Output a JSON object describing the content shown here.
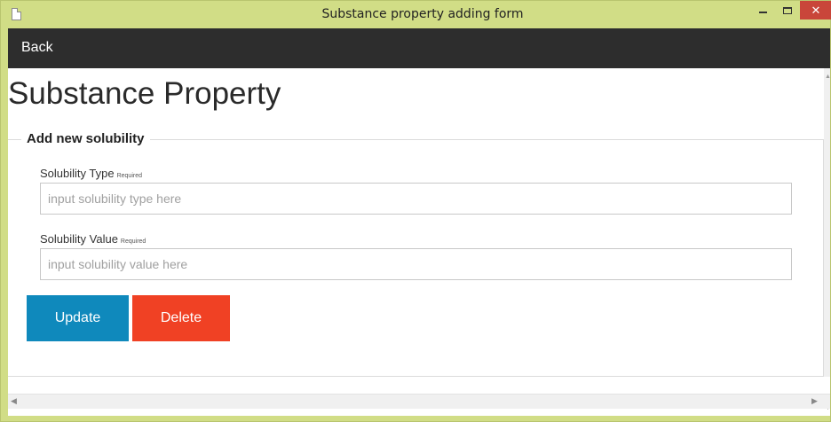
{
  "window": {
    "title": "Substance property adding form",
    "close_glyph": "✕"
  },
  "nav": {
    "back_label": "Back"
  },
  "page": {
    "title": "Substance Property"
  },
  "form": {
    "legend": "Add new solubility",
    "solubility_type": {
      "label": "Solubility Type",
      "required": "Required",
      "placeholder": "input solubility type here",
      "value": ""
    },
    "solubility_value": {
      "label": "Solubility Value",
      "required": "Required",
      "placeholder": "input solubility value here",
      "value": ""
    },
    "update_label": "Update",
    "delete_label": "Delete"
  },
  "colors": {
    "titlebar": "#d1dd86",
    "navbar": "#2d2d2d",
    "update": "#0f89bc",
    "delete": "#f04124",
    "close": "#c9463a"
  },
  "icons": {
    "app": "document-icon",
    "minimize": "minimize-icon",
    "maximize": "maximize-icon",
    "close": "close-icon"
  }
}
